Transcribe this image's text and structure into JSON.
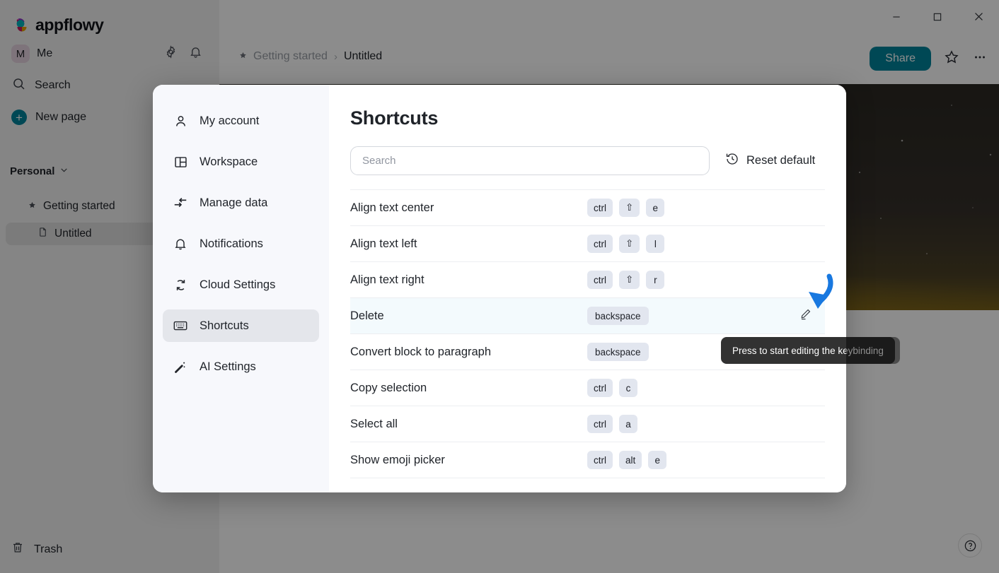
{
  "app": {
    "brand": "appflowy",
    "user": {
      "avatar_initial": "M",
      "name": "Me"
    },
    "icons": {
      "settings": "gear-icon",
      "notifications": "bell-icon"
    },
    "nav": [
      {
        "label": "Search",
        "icon": "search-icon"
      },
      {
        "label": "New page",
        "icon": "plus-circle-icon"
      }
    ],
    "section": {
      "label": "Personal",
      "chevron": "chevron-down-icon"
    },
    "tree": [
      {
        "label": "Getting started",
        "icon": "star-icon"
      },
      {
        "label": "Untitled",
        "icon": "document-icon",
        "selected": true
      }
    ],
    "trash": {
      "label": "Trash",
      "icon": "trash-icon"
    }
  },
  "window": {
    "minimize": "minimize-icon",
    "maximize": "maximize-icon",
    "close": "close-icon"
  },
  "topbar": {
    "breadcrumb": {
      "parent": "Getting started",
      "separator": "›",
      "current": "Untitled"
    },
    "share_label": "Share",
    "share_color": "#00849b",
    "favorite_icon": "star-outline-icon",
    "more_icon": "more-horizontal-icon"
  },
  "help": {
    "icon": "question-mark-icon"
  },
  "settings_dialog": {
    "nav_items": [
      {
        "label": "My account",
        "icon": "person-icon",
        "active": false
      },
      {
        "label": "Workspace",
        "icon": "layout-panel-icon",
        "active": false
      },
      {
        "label": "Manage data",
        "icon": "import-export-icon",
        "active": false
      },
      {
        "label": "Notifications",
        "icon": "bell-icon",
        "active": false
      },
      {
        "label": "Cloud Settings",
        "icon": "sync-icon",
        "active": false
      },
      {
        "label": "Shortcuts",
        "icon": "keyboard-icon",
        "active": true
      },
      {
        "label": "AI Settings",
        "icon": "magic-wand-icon",
        "active": false
      }
    ],
    "title": "Shortcuts",
    "search": {
      "placeholder": "Search",
      "value": ""
    },
    "reset": {
      "label": "Reset default",
      "icon": "history-icon"
    },
    "shortcuts": [
      {
        "command": "Align text center",
        "keys": [
          "ctrl",
          "⇧",
          "e"
        ],
        "highlighted": false
      },
      {
        "command": "Align text left",
        "keys": [
          "ctrl",
          "⇧",
          "l"
        ],
        "highlighted": false
      },
      {
        "command": "Align text right",
        "keys": [
          "ctrl",
          "⇧",
          "r"
        ],
        "highlighted": false
      },
      {
        "command": "Delete",
        "keys": [
          "backspace"
        ],
        "highlighted": true
      },
      {
        "command": "Convert block to paragraph",
        "keys": [
          "backspace"
        ],
        "highlighted": false
      },
      {
        "command": "Copy selection",
        "keys": [
          "ctrl",
          "c"
        ],
        "highlighted": false
      },
      {
        "command": "Select all",
        "keys": [
          "ctrl",
          "a"
        ],
        "highlighted": false
      },
      {
        "command": "Show emoji picker",
        "keys": [
          "ctrl",
          "alt",
          "e"
        ],
        "highlighted": false
      }
    ],
    "edit_icon": "pencil-icon"
  },
  "tooltip": {
    "text": "Press to start editing the keybinding"
  },
  "annotation": {
    "type": "curved-arrow",
    "color": "#1878e0"
  }
}
